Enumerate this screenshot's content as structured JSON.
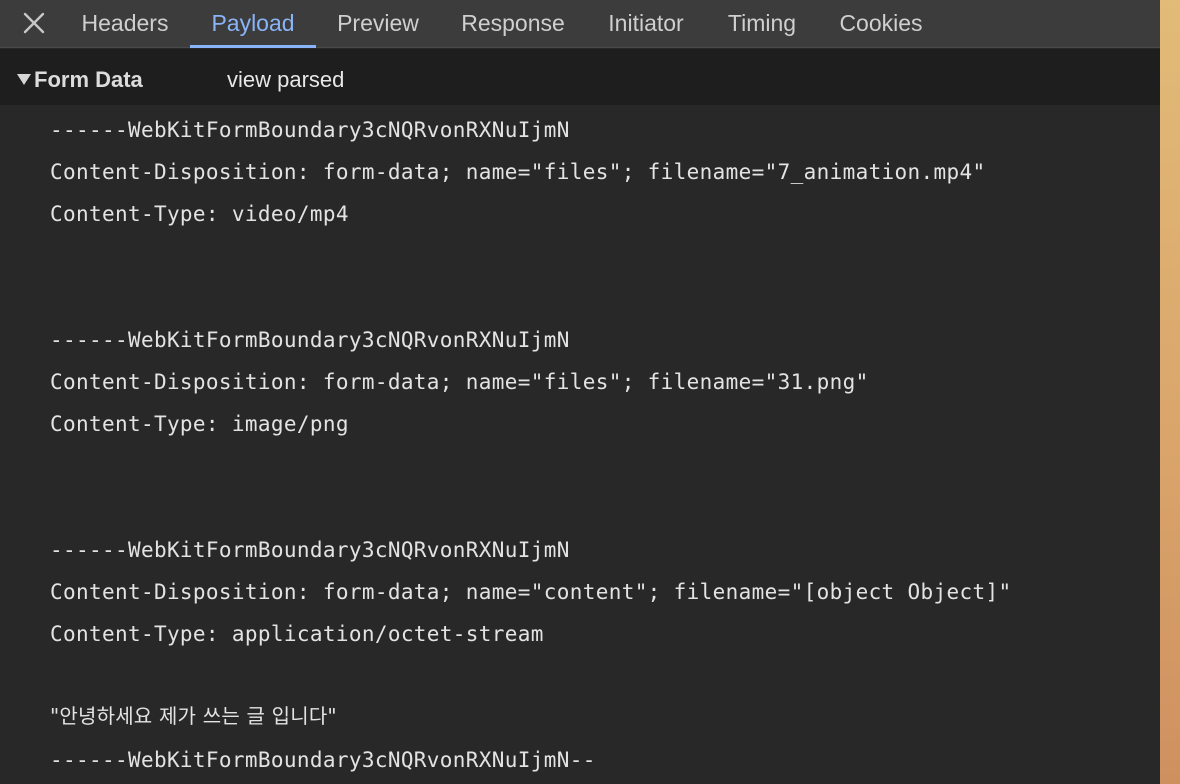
{
  "tabs": [
    "Headers",
    "Payload",
    "Preview",
    "Response",
    "Initiator",
    "Timing",
    "Cookies"
  ],
  "active_tab": "Payload",
  "close_icon": "close-icon",
  "section": {
    "title": "Form Data",
    "toggle_icon": "triangle-down-icon",
    "view_link": "view parsed"
  },
  "body_lines": [
    "------WebKitFormBoundary3cNQRvonRXNuIjmN",
    "Content-Disposition: form-data; name=\"files\"; filename=\"7_animation.mp4\"",
    "Content-Type: video/mp4",
    "------WebKitFormBoundary3cNQRvonRXNuIjmN",
    "Content-Disposition: form-data; name=\"files\"; filename=\"31.png\"",
    "Content-Type: image/png",
    "------WebKitFormBoundary3cNQRvonRXNuIjmN",
    "Content-Disposition: form-data; name=\"content\"; filename=\"[object Object]\"",
    "Content-Type: application/octet-stream",
    "\"안녕하세요 제가 쓰는 글 입니다\"",
    "------WebKitFormBoundary3cNQRvonRXNuIjmN--"
  ],
  "colors": {
    "active_tab": "#8ab4f8",
    "tabbar_bg": "#3c3c3c",
    "panel_bg": "#282828",
    "section_bg": "#1e1e1e",
    "text": "#e3e3e3"
  }
}
